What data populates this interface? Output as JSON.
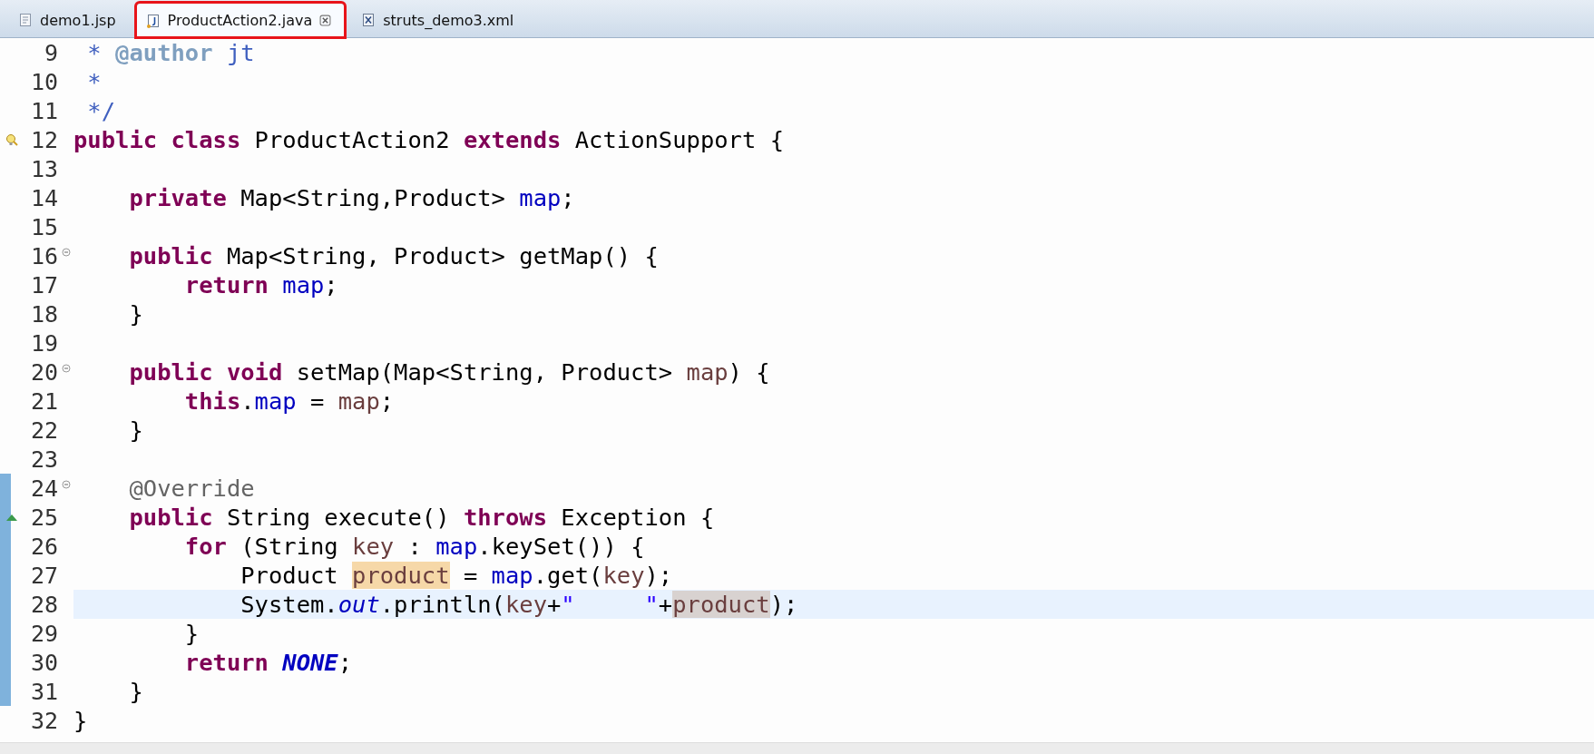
{
  "tabs": [
    {
      "label": "demo1.jsp",
      "kind": "jsp",
      "selected": false,
      "closable": false,
      "highlighted": false
    },
    {
      "label": "ProductAction2.java",
      "kind": "java",
      "selected": true,
      "closable": true,
      "highlighted": true
    },
    {
      "label": "struts_demo3.xml",
      "kind": "xml",
      "selected": false,
      "closable": false,
      "highlighted": false
    }
  ],
  "lines": [
    {
      "number": "9",
      "kind": "plain",
      "foldable": false,
      "changed": false,
      "current": false,
      "segments": [
        {
          "kind": "doc",
          "text": " * "
        },
        {
          "kind": "doctag",
          "text": "@author"
        },
        {
          "kind": "doc",
          "text": " jt"
        }
      ]
    },
    {
      "number": "10",
      "kind": "plain",
      "foldable": false,
      "changed": false,
      "current": false,
      "segments": [
        {
          "kind": "doc",
          "text": " *"
        }
      ]
    },
    {
      "number": "11",
      "kind": "plain",
      "foldable": false,
      "changed": false,
      "current": false,
      "segments": [
        {
          "kind": "doc",
          "text": " */"
        }
      ]
    },
    {
      "number": "12",
      "kind": "warning",
      "foldable": false,
      "changed": false,
      "current": false,
      "segments": [
        {
          "kind": "kw",
          "text": "public class "
        },
        {
          "kind": "text",
          "text": "ProductAction2 "
        },
        {
          "kind": "kw",
          "text": "extends "
        },
        {
          "kind": "text",
          "text": "ActionSupport {"
        }
      ]
    },
    {
      "number": "13",
      "kind": "plain",
      "foldable": false,
      "changed": false,
      "current": false
    },
    {
      "number": "14",
      "kind": "plain",
      "foldable": false,
      "changed": false,
      "current": false,
      "segments": [
        {
          "kind": "kw",
          "text": "    private "
        },
        {
          "kind": "text",
          "text": "Map<String,Product> "
        },
        {
          "kind": "field",
          "text": "map"
        },
        {
          "kind": "text",
          "text": ";"
        }
      ]
    },
    {
      "number": "15",
      "kind": "plain",
      "foldable": false,
      "changed": false,
      "current": false
    },
    {
      "number": "16",
      "kind": "plain",
      "foldable": true,
      "changed": false,
      "current": false,
      "segments": [
        {
          "kind": "kw",
          "text": "    public "
        },
        {
          "kind": "text",
          "text": "Map<String, Product> getMap() {"
        }
      ]
    },
    {
      "number": "17",
      "kind": "plain",
      "foldable": false,
      "changed": false,
      "current": false,
      "segments": [
        {
          "kind": "kw",
          "text": "        return "
        },
        {
          "kind": "field",
          "text": "map"
        },
        {
          "kind": "text",
          "text": ";"
        }
      ]
    },
    {
      "number": "18",
      "kind": "plain",
      "foldable": false,
      "changed": false,
      "current": false,
      "segments": [
        {
          "kind": "text",
          "text": "    }"
        }
      ]
    },
    {
      "number": "19",
      "kind": "plain",
      "foldable": false,
      "changed": false,
      "current": false
    },
    {
      "number": "20",
      "kind": "plain",
      "foldable": true,
      "changed": false,
      "current": false,
      "segments": [
        {
          "kind": "kw",
          "text": "    public void "
        },
        {
          "kind": "text",
          "text": "setMap(Map<String, Product> "
        },
        {
          "kind": "var",
          "text": "map"
        },
        {
          "kind": "text",
          "text": ") {"
        }
      ]
    },
    {
      "number": "21",
      "kind": "plain",
      "foldable": false,
      "changed": false,
      "current": false,
      "segments": [
        {
          "kind": "kw",
          "text": "        this"
        },
        {
          "kind": "text",
          "text": "."
        },
        {
          "kind": "field",
          "text": "map"
        },
        {
          "kind": "text",
          "text": " = "
        },
        {
          "kind": "var",
          "text": "map"
        },
        {
          "kind": "text",
          "text": ";"
        }
      ]
    },
    {
      "number": "22",
      "kind": "plain",
      "foldable": false,
      "changed": false,
      "current": false,
      "segments": [
        {
          "kind": "text",
          "text": "    }"
        }
      ]
    },
    {
      "number": "23",
      "kind": "plain",
      "foldable": false,
      "changed": false,
      "current": false
    },
    {
      "number": "24",
      "kind": "plain",
      "foldable": true,
      "changed": true,
      "current": false,
      "segments": [
        {
          "kind": "ann",
          "text": "    @Override"
        }
      ]
    },
    {
      "number": "25",
      "kind": "override",
      "foldable": false,
      "changed": true,
      "current": false,
      "segments": [
        {
          "kind": "kw",
          "text": "    public "
        },
        {
          "kind": "text",
          "text": "String execute() "
        },
        {
          "kind": "kw",
          "text": "throws "
        },
        {
          "kind": "text",
          "text": "Exception {"
        }
      ]
    },
    {
      "number": "26",
      "kind": "plain",
      "foldable": false,
      "changed": true,
      "current": false,
      "segments": [
        {
          "kind": "kw",
          "text": "        for "
        },
        {
          "kind": "text",
          "text": "(String "
        },
        {
          "kind": "var",
          "text": "key"
        },
        {
          "kind": "text",
          "text": " : "
        },
        {
          "kind": "field",
          "text": "map"
        },
        {
          "kind": "text",
          "text": ".keySet()) {"
        }
      ]
    },
    {
      "number": "27",
      "kind": "plain",
      "foldable": false,
      "changed": true,
      "current": false,
      "segments": [
        {
          "kind": "text",
          "text": "            Product "
        },
        {
          "kind": "var_write",
          "text": "product"
        },
        {
          "kind": "text",
          "text": " = "
        },
        {
          "kind": "field",
          "text": "map"
        },
        {
          "kind": "text",
          "text": ".get("
        },
        {
          "kind": "var",
          "text": "key"
        },
        {
          "kind": "text",
          "text": ");"
        }
      ]
    },
    {
      "number": "28",
      "kind": "plain",
      "foldable": false,
      "changed": true,
      "current": true,
      "segments": [
        {
          "kind": "text",
          "text": "            System."
        },
        {
          "kind": "static",
          "text": "out"
        },
        {
          "kind": "text",
          "text": ".println("
        },
        {
          "kind": "var",
          "text": "key"
        },
        {
          "kind": "text",
          "text": "+"
        },
        {
          "kind": "str",
          "text": "\"     \""
        },
        {
          "kind": "text",
          "text": "+"
        },
        {
          "kind": "var_read",
          "text": "product"
        },
        {
          "kind": "text",
          "text": ");"
        }
      ]
    },
    {
      "number": "29",
      "kind": "plain",
      "foldable": false,
      "changed": true,
      "current": false,
      "segments": [
        {
          "kind": "text",
          "text": "        }"
        }
      ]
    },
    {
      "number": "30",
      "kind": "plain",
      "foldable": false,
      "changed": true,
      "current": false,
      "segments": [
        {
          "kind": "kw",
          "text": "        return "
        },
        {
          "kind": "const",
          "text": "NONE"
        },
        {
          "kind": "text",
          "text": ";"
        }
      ]
    },
    {
      "number": "31",
      "kind": "plain",
      "foldable": false,
      "changed": true,
      "current": false,
      "segments": [
        {
          "kind": "text",
          "text": "    }"
        }
      ]
    },
    {
      "number": "32",
      "kind": "plain",
      "foldable": false,
      "changed": false,
      "current": false,
      "segments": [
        {
          "kind": "text",
          "text": "}"
        }
      ]
    }
  ]
}
